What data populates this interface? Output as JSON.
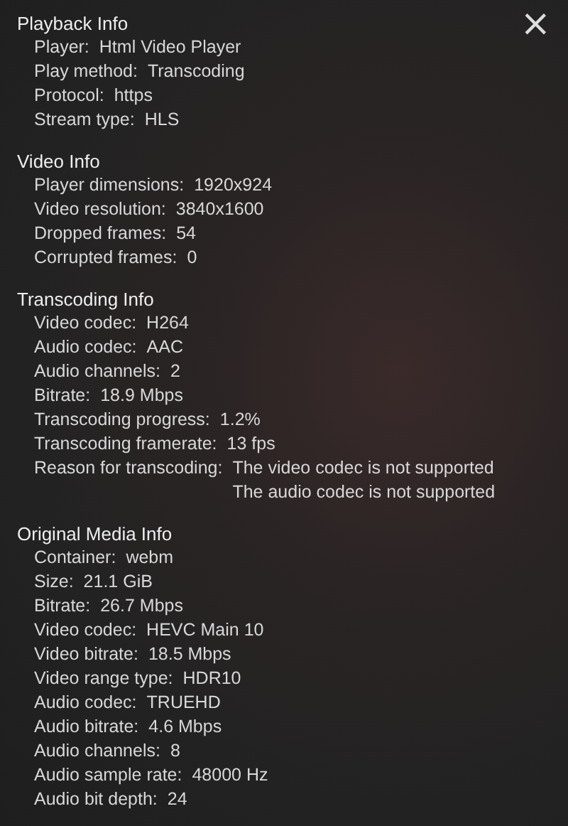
{
  "close_button": {
    "label": "×"
  },
  "sections": [
    {
      "title": "Playback Info",
      "rows": [
        {
          "label": "Player:",
          "values": [
            "Html Video Player"
          ]
        },
        {
          "label": "Play method:",
          "values": [
            "Transcoding"
          ]
        },
        {
          "label": "Protocol:",
          "values": [
            "https"
          ]
        },
        {
          "label": "Stream type:",
          "values": [
            "HLS"
          ]
        }
      ]
    },
    {
      "title": "Video Info",
      "rows": [
        {
          "label": "Player dimensions:",
          "values": [
            "1920x924"
          ]
        },
        {
          "label": "Video resolution:",
          "values": [
            "3840x1600"
          ]
        },
        {
          "label": "Dropped frames:",
          "values": [
            "54"
          ]
        },
        {
          "label": "Corrupted frames:",
          "values": [
            "0"
          ]
        }
      ]
    },
    {
      "title": "Transcoding Info",
      "rows": [
        {
          "label": "Video codec:",
          "values": [
            "H264"
          ]
        },
        {
          "label": "Audio codec:",
          "values": [
            "AAC"
          ]
        },
        {
          "label": "Audio channels:",
          "values": [
            "2"
          ]
        },
        {
          "label": "Bitrate:",
          "values": [
            "18.9 Mbps"
          ]
        },
        {
          "label": "Transcoding progress:",
          "values": [
            "1.2%"
          ]
        },
        {
          "label": "Transcoding framerate:",
          "values": [
            "13 fps"
          ]
        },
        {
          "label": "Reason for transcoding:",
          "values": [
            "The video codec is not supported",
            "The audio codec is not supported"
          ]
        }
      ]
    },
    {
      "title": "Original Media Info",
      "rows": [
        {
          "label": "Container:",
          "values": [
            "webm"
          ]
        },
        {
          "label": "Size:",
          "values": [
            "21.1 GiB"
          ]
        },
        {
          "label": "Bitrate:",
          "values": [
            "26.7 Mbps"
          ]
        },
        {
          "label": "Video codec:",
          "values": [
            "HEVC Main 10"
          ]
        },
        {
          "label": "Video bitrate:",
          "values": [
            "18.5 Mbps"
          ]
        },
        {
          "label": "Video range type:",
          "values": [
            "HDR10"
          ]
        },
        {
          "label": "Audio codec:",
          "values": [
            "TRUEHD"
          ]
        },
        {
          "label": "Audio bitrate:",
          "values": [
            "4.6 Mbps"
          ]
        },
        {
          "label": "Audio channels:",
          "values": [
            "8"
          ]
        },
        {
          "label": "Audio sample rate:",
          "values": [
            "48000 Hz"
          ]
        },
        {
          "label": "Audio bit depth:",
          "values": [
            "24"
          ]
        }
      ]
    }
  ]
}
